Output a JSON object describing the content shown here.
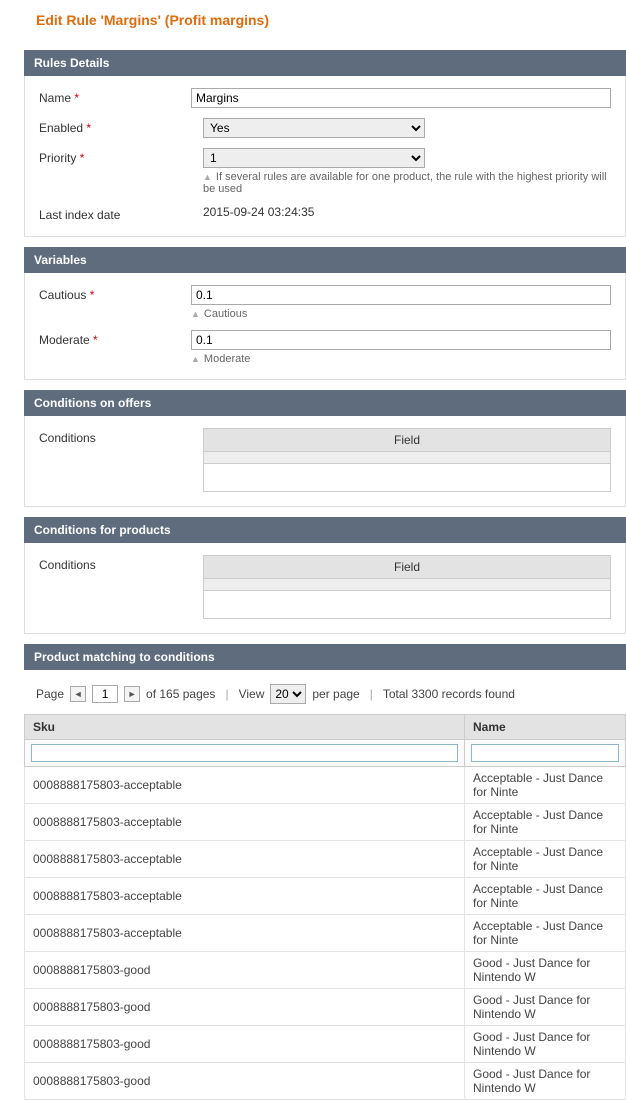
{
  "page_title": "Edit Rule 'Margins' (Profit margins)",
  "sections": {
    "rules_details": {
      "header": "Rules Details",
      "name_label": "Name",
      "name_value": "Margins",
      "enabled_label": "Enabled",
      "enabled_value": "Yes",
      "priority_label": "Priority",
      "priority_value": "1",
      "priority_hint": "If several rules are available for one product, the rule with the highest priority will be used",
      "lastindex_label": "Last index date",
      "lastindex_value": "2015-09-24 03:24:35"
    },
    "variables": {
      "header": "Variables",
      "cautious_label": "Cautious",
      "cautious_value": "0.1",
      "cautious_sub": "Cautious",
      "moderate_label": "Moderate",
      "moderate_value": "0.1",
      "moderate_sub": "Moderate"
    },
    "conditions_offers": {
      "header": "Conditions on offers",
      "conditions_label": "Conditions",
      "field_header": "Field"
    },
    "conditions_products": {
      "header": "Conditions for products",
      "conditions_label": "Conditions",
      "field_header": "Field"
    },
    "matching": {
      "header": "Product matching to conditions"
    }
  },
  "pager": {
    "page_label": "Page",
    "page_value": "1",
    "of_pages": "of 165 pages",
    "view_label": "View",
    "per_page_value": "20",
    "per_page_label": "per page",
    "total_label": "Total 3300 records found"
  },
  "table": {
    "col_sku": "Sku",
    "col_name": "Name",
    "rows": [
      {
        "sku": "0008888175803-acceptable",
        "name": "Acceptable - Just Dance for Ninte"
      },
      {
        "sku": "0008888175803-acceptable",
        "name": "Acceptable - Just Dance for Ninte"
      },
      {
        "sku": "0008888175803-acceptable",
        "name": "Acceptable - Just Dance for Ninte"
      },
      {
        "sku": "0008888175803-acceptable",
        "name": "Acceptable - Just Dance for Ninte"
      },
      {
        "sku": "0008888175803-acceptable",
        "name": "Acceptable - Just Dance for Ninte"
      },
      {
        "sku": "0008888175803-good",
        "name": "Good - Just Dance for Nintendo W"
      },
      {
        "sku": "0008888175803-good",
        "name": "Good - Just Dance for Nintendo W"
      },
      {
        "sku": "0008888175803-good",
        "name": "Good - Just Dance for Nintendo W"
      },
      {
        "sku": "0008888175803-good",
        "name": "Good - Just Dance for Nintendo W"
      }
    ]
  }
}
